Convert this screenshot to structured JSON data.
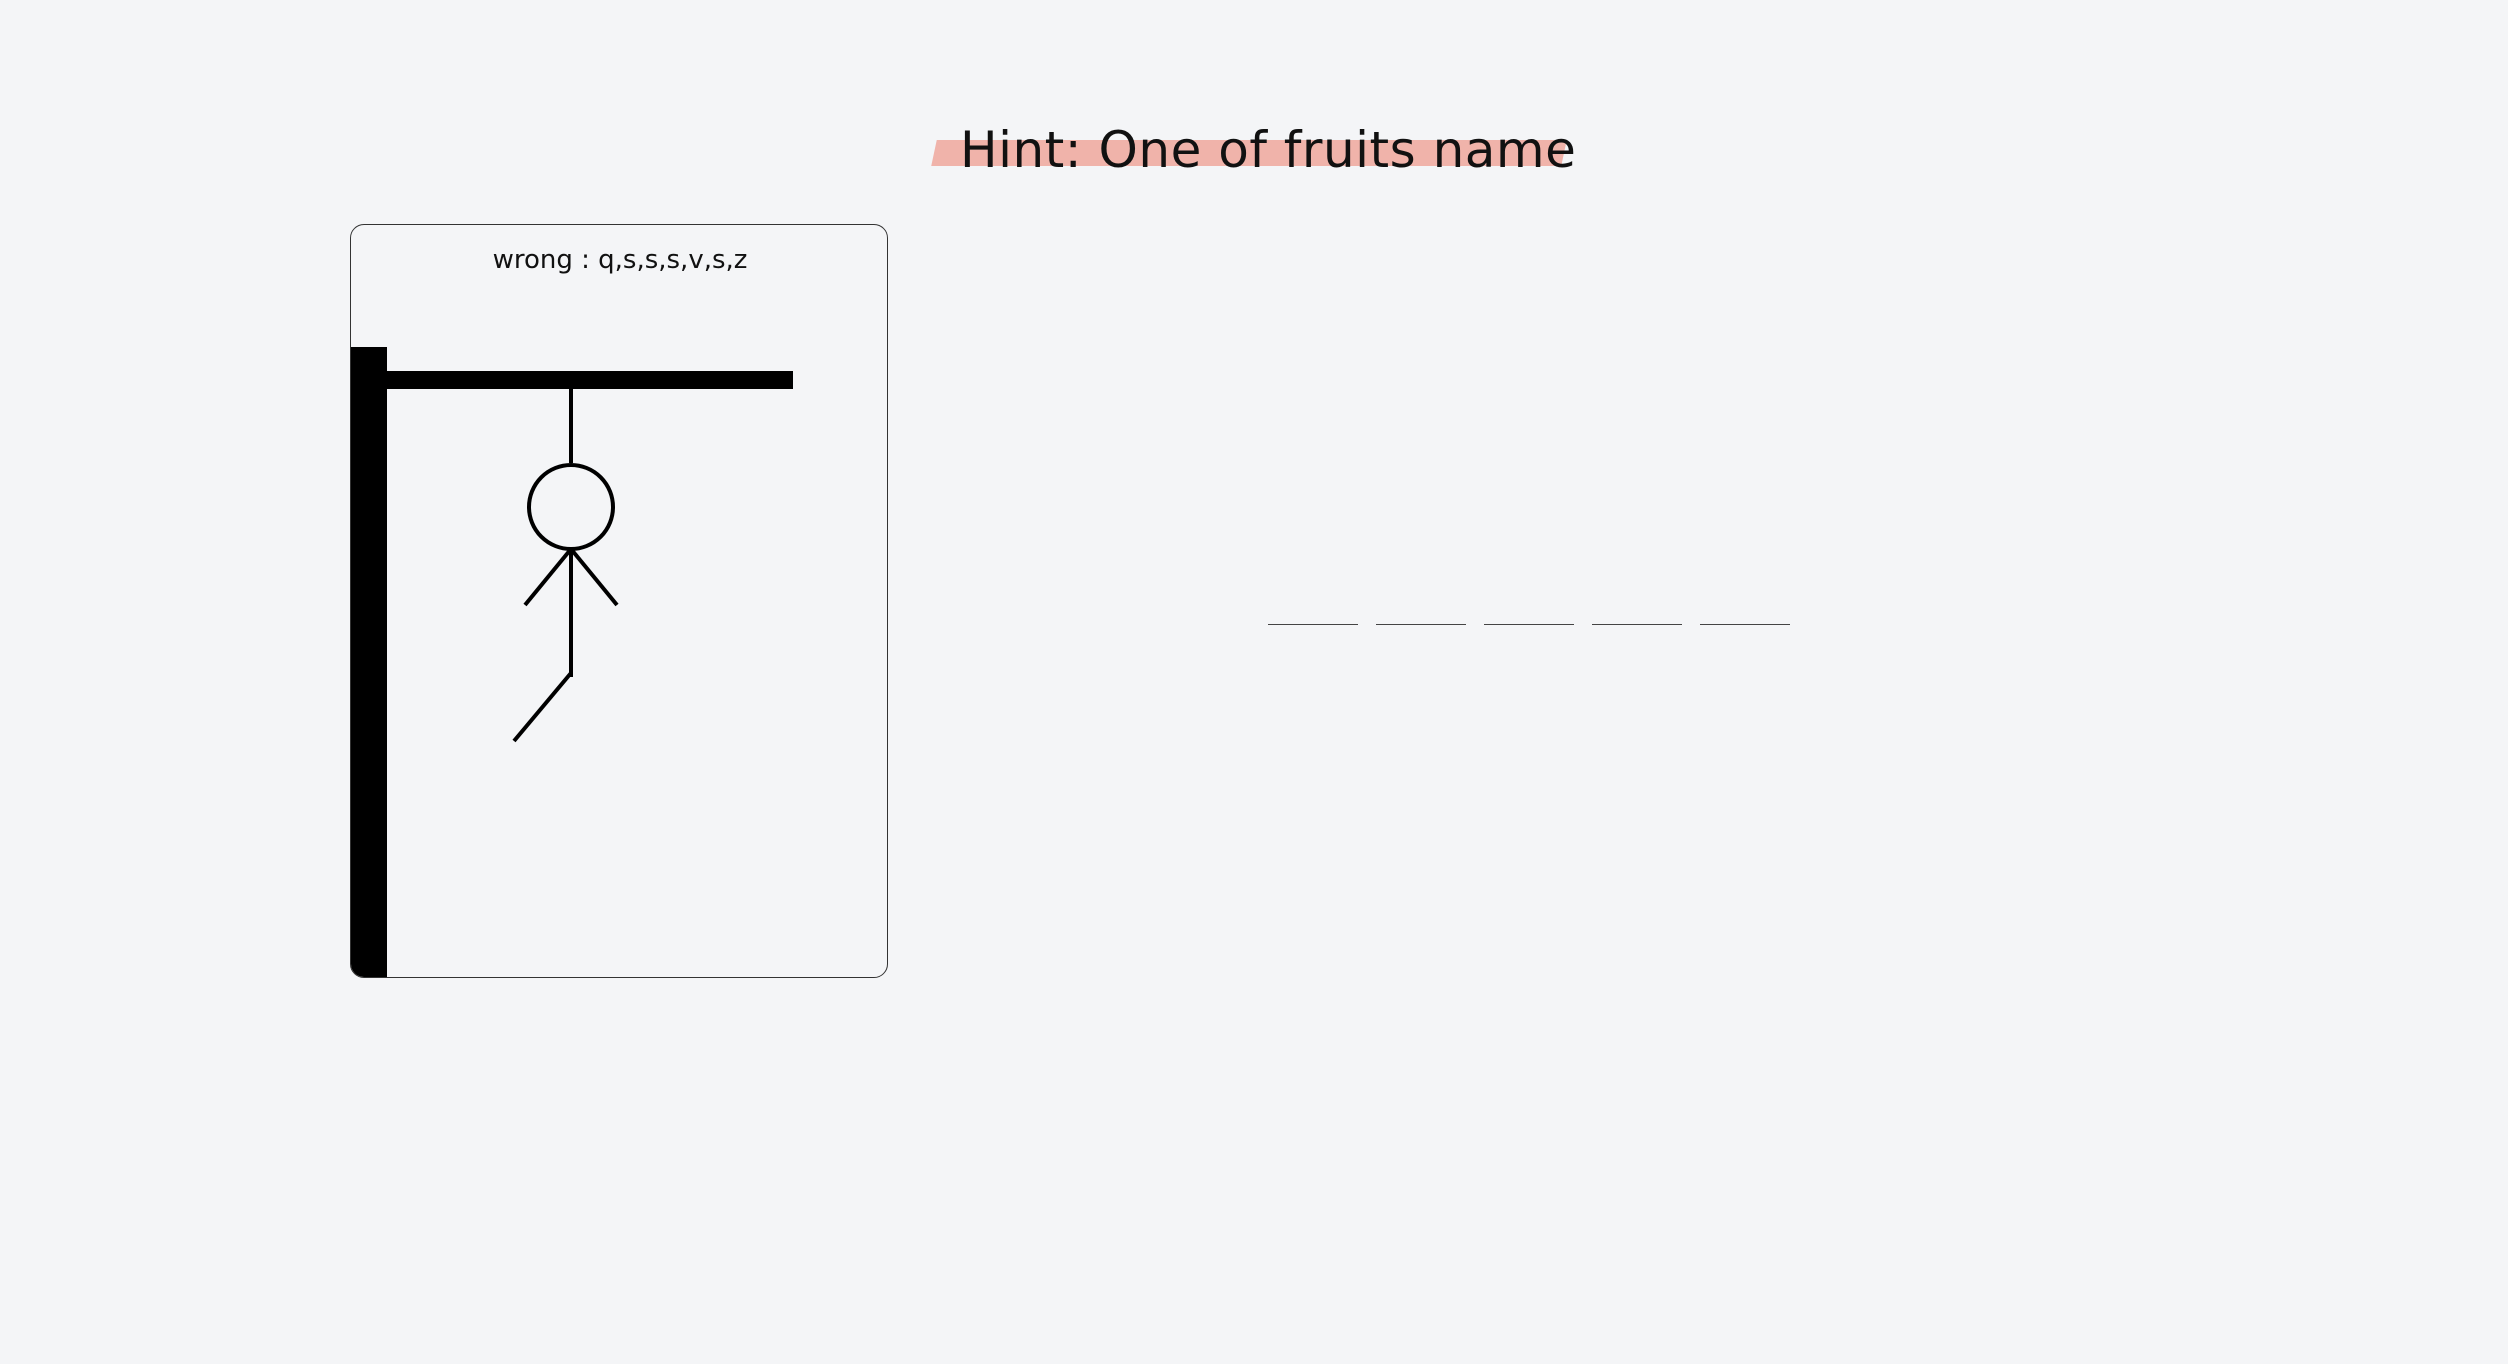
{
  "hint": {
    "text": "Hint: One of fruits name",
    "highlight_color": "#f0b3aa"
  },
  "gallows": {
    "wrong_label": "wrong :",
    "wrong_letters": "q,s,s,s,v,s,z",
    "drawn_parts": [
      "head",
      "body",
      "left-arm",
      "right-arm",
      "left-leg"
    ],
    "wrong_count": 5
  },
  "word": {
    "letters": [
      "",
      "",
      "",
      "",
      ""
    ],
    "length": 5
  }
}
